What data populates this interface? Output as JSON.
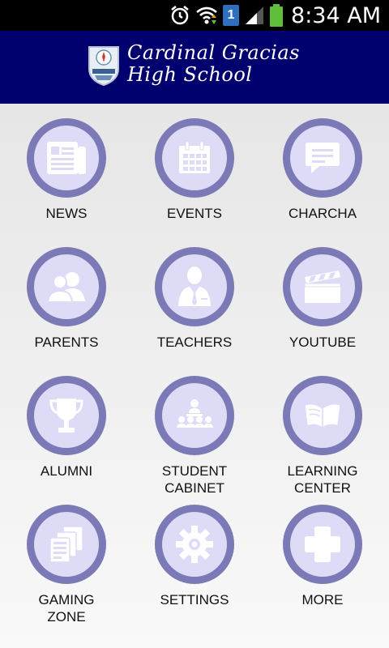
{
  "status_bar": {
    "time": "8:34 AM",
    "sim_number": "1",
    "icons": [
      "alarm-icon",
      "wifi-icon",
      "sim-icon",
      "signal-icon",
      "battery-icon"
    ]
  },
  "header": {
    "title_line1": "Cardinal Gracias",
    "title_line2": "High School",
    "background_color": "#00006e"
  },
  "colors": {
    "ring": "#7b79b6",
    "circle_fill": "#dddbf6"
  },
  "menu": [
    {
      "label_line1": "NEWS",
      "label_line2": "",
      "icon": "newspaper-icon"
    },
    {
      "label_line1": "EVENTS",
      "label_line2": "",
      "icon": "calendar-icon"
    },
    {
      "label_line1": "CHARCHA",
      "label_line2": "",
      "icon": "chat-icon"
    },
    {
      "label_line1": "PARENTS",
      "label_line2": "",
      "icon": "parents-icon"
    },
    {
      "label_line1": "TEACHERS",
      "label_line2": "",
      "icon": "teacher-icon"
    },
    {
      "label_line1": "YOUTUBE",
      "label_line2": "",
      "icon": "clapperboard-icon"
    },
    {
      "label_line1": "ALUMNI",
      "label_line2": "",
      "icon": "trophy-icon"
    },
    {
      "label_line1": "STUDENT",
      "label_line2": "CABINET",
      "icon": "cabinet-icon"
    },
    {
      "label_line1": "LEARNING",
      "label_line2": "CENTER",
      "icon": "book-icon"
    },
    {
      "label_line1": "GAMING",
      "label_line2": "ZONE",
      "icon": "cards-icon"
    },
    {
      "label_line1": "SETTINGS",
      "label_line2": "",
      "icon": "gear-icon"
    },
    {
      "label_line1": "MORE",
      "label_line2": "",
      "icon": "plus-icon"
    }
  ]
}
